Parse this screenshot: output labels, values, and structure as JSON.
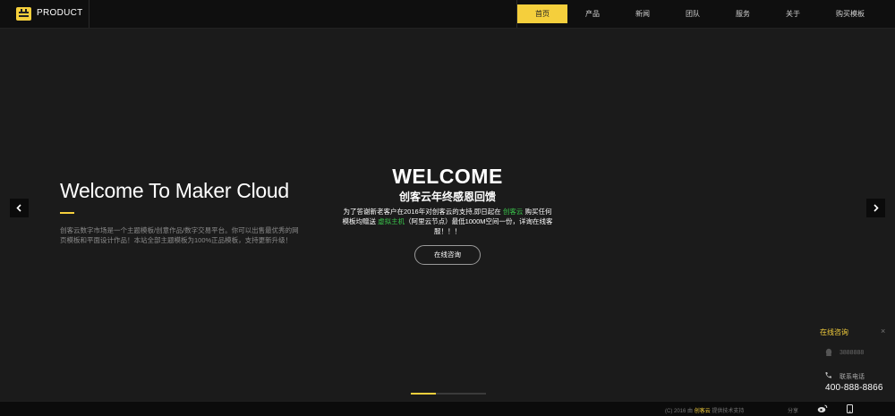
{
  "brand": {
    "name": "PRODUCT",
    "logo_icon": "box-logo-icon"
  },
  "nav": [
    {
      "label": "首页",
      "active": true
    },
    {
      "label": "产品"
    },
    {
      "label": "新闻"
    },
    {
      "label": "团队"
    },
    {
      "label": "服务"
    },
    {
      "label": "关于"
    },
    {
      "label": "购买模板"
    }
  ],
  "hero": {
    "left_title": "Welcome To Maker Cloud",
    "left_desc": "创客云数字市场是一个主题模板/创意作品/数字交易平台。你可以出售最优秀的网页模板和平面设计作品！本站全部主题模板为100%正品模板，支持更新升级！",
    "welcome": "WELCOME",
    "subtitle": "创客云年终感恩回馈",
    "promo_part1": "为了答谢新老客户在2016年对创客云的支持,即日起在",
    "promo_hl1": "创客云",
    "promo_part2": "购买任何模板均赠送",
    "promo_hl2": "虚拟主机",
    "promo_part3": "（阿里云节点）最低1000M空间一份，详询在线客服！！！",
    "button": "在线咨询",
    "slides": 3,
    "active_slide": 1
  },
  "side_panel": {
    "title": "在线咨询",
    "close": "×",
    "qq": "3888888",
    "phone_label": "联系电话",
    "phone": "400-888-8866"
  },
  "footer": {
    "copy_prefix": "(C) 2016 由",
    "copy_brand": "创客云",
    "copy_suffix": "提供技术支持",
    "share": "分享"
  },
  "colors": {
    "accent": "#f5cf3c",
    "highlight": "#39c24a",
    "background": "#1b1b1b"
  }
}
